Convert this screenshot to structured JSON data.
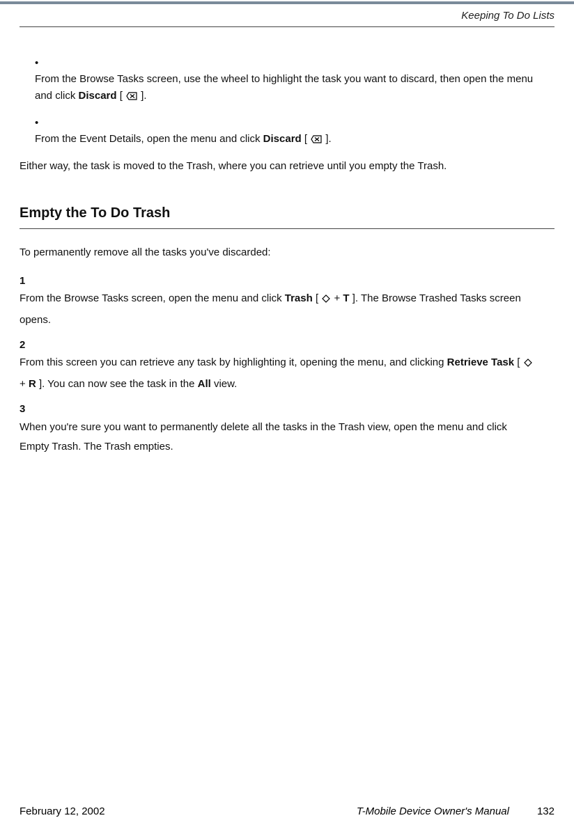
{
  "header": {
    "section_title": "Keeping To Do Lists"
  },
  "body": {
    "bullet1_a": "From the Browse Tasks screen, use the wheel to highlight the task you want to discard, then open the menu and click ",
    "bullet1_b_bold": "Discard",
    "bullet1_c": " [ ",
    "bullet1_d": " ].",
    "bullet2_a": "From the Event Details, open the menu and click ",
    "bullet2_b_bold": "Discard",
    "bullet2_c": " [ ",
    "bullet2_d": " ].",
    "closing": "Either way, the task is moved to the Trash, where you can retrieve until you empty the Trash."
  },
  "section": {
    "heading": "Empty the To Do Trash",
    "intro": "To permanently remove all the tasks you've discarded:",
    "steps": {
      "n1": "1",
      "s1_a": "From the Browse Tasks screen, open the menu and click ",
      "s1_b_bold": "Trash",
      "s1_c": " [ ",
      "s1_d": " + ",
      "s1_e_bold": "T",
      "s1_f": " ]. The Browse Trashed Tasks screen opens.",
      "n2": "2",
      "s2_a": "From this screen you can retrieve any task by highlighting it, opening the menu, and clicking ",
      "s2_b_bold": "Retrieve Task",
      "s2_c": " [ ",
      "s2_d": " + ",
      "s2_e_bold": "R",
      "s2_f": " ]. You can now see the task in the ",
      "s2_g_bold": "All",
      "s2_h": " view.",
      "n3": "3",
      "s3": "When you're sure you want to permanently delete all the tasks in the Trash view, open the menu and click Empty Trash. The Trash empties."
    }
  },
  "footer": {
    "date": "February 12, 2002",
    "manual": "T-Mobile Device Owner's Manual",
    "page": "132"
  }
}
